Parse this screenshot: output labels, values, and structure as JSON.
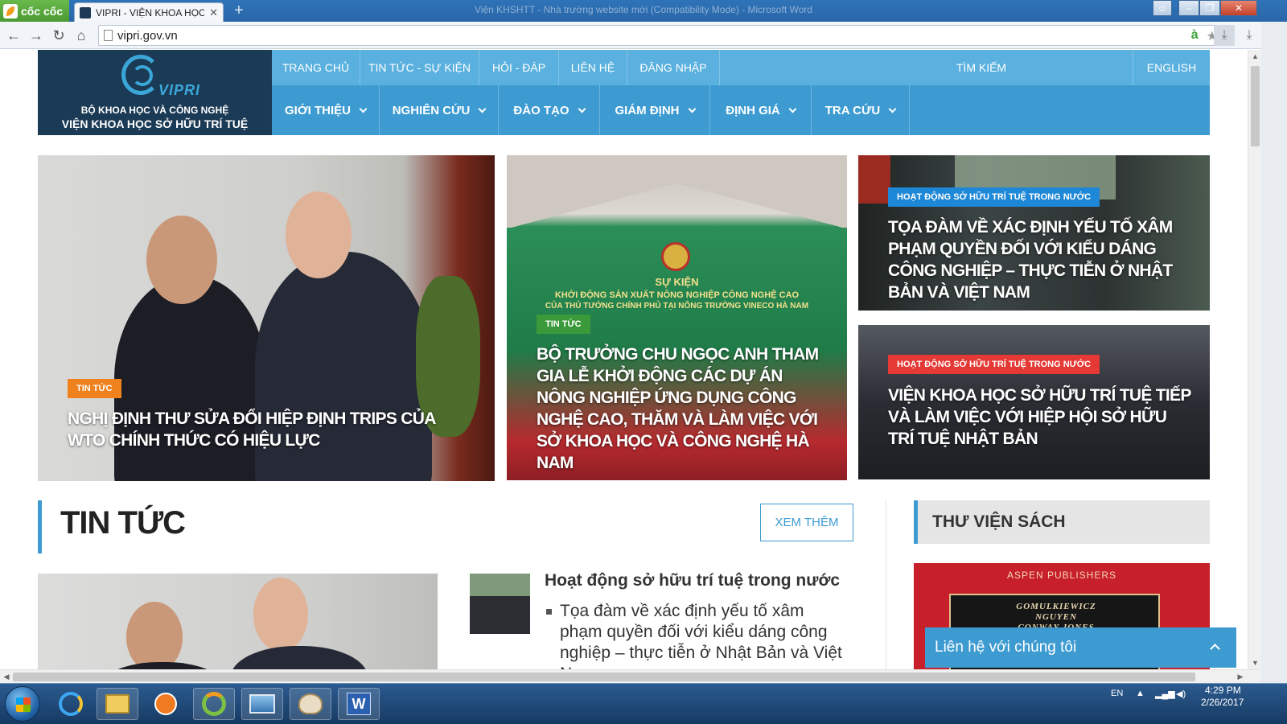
{
  "browser": {
    "brand_label": "cốc cốc",
    "tab_title": "VIPRI - VIỆN KHOA HỌC SỞ",
    "tab_close": "✕",
    "new_tab": "+",
    "window_title": "Viện KHSHTT - Nhà trường website mới (Compatibility Mode) - Microsoft Word",
    "back_icon": "←",
    "forward_icon": "→",
    "reload_icon": "↻",
    "home_icon": "⌂",
    "url": "vipri.gov.vn",
    "addr_a": "à",
    "star": "★",
    "download": "⤓",
    "win_min": "–",
    "win_max": "❐",
    "win_close": "✕",
    "win_user": "☺"
  },
  "site": {
    "logo_word": "VIPRI",
    "logo_line1": "BỘ KHOA HỌC VÀ CÔNG NGHỆ",
    "logo_line2": "VIỆN KHOA HỌC SỞ HỮU TRÍ TUỆ",
    "nav_top": [
      "TRANG CHỦ",
      "TIN TỨC - SỰ KIỆN",
      "HỎI - ĐÁP",
      "LIÊN HỆ",
      "ĐĂNG NHẬP"
    ],
    "search_label": "TÌM KIẾM",
    "lang_label": "ENGLISH",
    "nav_main": [
      "GIỚI THIỆU",
      "NGHIÊN CỨU",
      "ĐÀO TẠO",
      "GIÁM ĐỊNH",
      "ĐỊNH GIÁ",
      "TRA CỨU"
    ]
  },
  "features": [
    {
      "category": "TIN TỨC",
      "title": "NGHỊ ĐỊNH THƯ SỬA ĐỔI HIỆP ĐỊNH TRIPS CỦA WTO CHÍNH THỨC CÓ HIỆU LỰC",
      "badge_color": "#f0821e"
    },
    {
      "category": "TIN TỨC",
      "title": "BỘ TRƯỞNG CHU NGỌC ANH THAM GIA LỄ KHỞI ĐỘNG CÁC DỰ ÁN NÔNG NGHIỆP ỨNG DỤNG CÔNG NGHỆ CAO, THĂM VÀ LÀM VIỆC VỚI SỞ KHOA HỌC VÀ CÔNG NGHỆ HÀ NAM",
      "badge_color": "#3a9a3a",
      "banner_l1": "SỰ KIỆN",
      "banner_l2": "KHỞI ĐỘNG SẢN XUẤT NÔNG NGHIỆP CÔNG NGHỆ CAO",
      "banner_l3": "CỦA THỦ TƯỚNG CHÍNH PHỦ TẠI NÔNG TRƯỜNG VINECO HÀ NAM"
    },
    {
      "category": "HOẠT ĐỘNG SỞ HỮU TRÍ TUỆ TRONG NƯỚC",
      "title": "TỌA ĐÀM VỀ XÁC ĐỊNH YẾU TỐ XÂM PHẠM QUYỀN ĐỐI VỚI KIỂU DÁNG CÔNG NGHIỆP – THỰC TIỄN Ở NHẬT BẢN VÀ VIỆT NAM",
      "badge_color": "#1e88d8"
    },
    {
      "category": "HOẠT ĐỘNG SỞ HỮU TRÍ TUỆ TRONG NƯỚC",
      "title": "VIỆN KHOA HỌC SỞ HỮU TRÍ TUỆ TIẾP VÀ LÀM VIỆC VỚI HIỆP HỘI SỞ HỮU TRÍ TUỆ NHẬT BẢN",
      "badge_color": "#e53935"
    }
  ],
  "news": {
    "section_title": "TIN TỨC",
    "more_label": "XEM THÊM",
    "category": "Hoạt động sở hữu trí tuệ trong nước",
    "item": "Tọa đàm về xác định yếu tố xâm phạm quyền đối với kiểu dáng công nghiệp – thực tiễn ở Nhật Bản và Việt Nam"
  },
  "library": {
    "title": "THƯ VIỆN SÁCH",
    "publisher": "ASPEN PUBLISHERS",
    "authors": [
      "GOMULKIEWICZ",
      "NGUYEN",
      "CONWAY-JONES"
    ]
  },
  "contact": {
    "label": "Liên hệ với chúng tôi"
  },
  "taskbar": {
    "lang": "EN",
    "time": "4:29 PM",
    "date": "2/26/2017",
    "word_label": "W"
  },
  "colors": {
    "accent": "#3d9bd2",
    "nav_top": "#5ab0de",
    "logo_bg": "#1b3a55"
  }
}
